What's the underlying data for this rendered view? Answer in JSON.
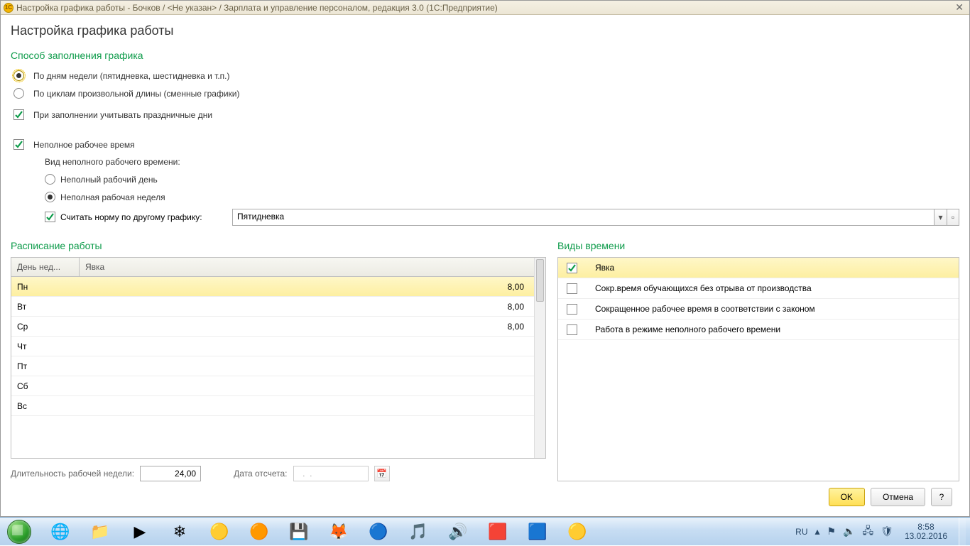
{
  "titlebar": "Настройка графика работы - Бочков / <Не указан> / Зарплата и управление персоналом, редакция 3.0  (1С:Предприятие)",
  "page_title": "Настройка графика работы",
  "sect_fill": "Способ заполнения графика",
  "radio_bydays": "По дням недели (пятидневка, шестидневка и т.п.)",
  "radio_bycycles": "По циклам произвольной длины (сменные графики)",
  "chk_holidays": "При заполнении учитывать праздничные дни",
  "chk_parttime": "Неполное рабочее время",
  "label_parttype": "Вид неполного рабочего времени:",
  "radio_partday": "Неполный рабочий день",
  "radio_partweek": "Неполная рабочая неделя",
  "chk_norm": "Считать норму по другому графику:",
  "norm_value": "Пятидневка",
  "sect_schedule": "Расписание работы",
  "sect_timetypes": "Виды времени",
  "col_day": "День нед...",
  "col_att": "Явка",
  "days": [
    {
      "d": "Пн",
      "v": "8,00"
    },
    {
      "d": "Вт",
      "v": "8,00"
    },
    {
      "d": "Ср",
      "v": "8,00"
    },
    {
      "d": "Чт",
      "v": ""
    },
    {
      "d": "Пт",
      "v": ""
    },
    {
      "d": "Сб",
      "v": ""
    },
    {
      "d": "Вс",
      "v": ""
    }
  ],
  "timetypes": [
    {
      "c": true,
      "t": "Явка"
    },
    {
      "c": false,
      "t": "Сокр.время обучающихся без отрыва от производства"
    },
    {
      "c": false,
      "t": "Сокращенное рабочее время в соответствии с законом"
    },
    {
      "c": false,
      "t": "Работа в режиме неполного рабочего времени"
    }
  ],
  "lbl_weeklen": "Длительность рабочей недели:",
  "val_weeklen": "24,00",
  "lbl_refdate": "Дата отсчета:",
  "val_refdate": "  .  .    ",
  "btn_ok": "OK",
  "btn_cancel": "Отмена",
  "btn_help": "?",
  "tray_lang": "RU",
  "tray_time": "8:58",
  "tray_date": "13.02.2016"
}
